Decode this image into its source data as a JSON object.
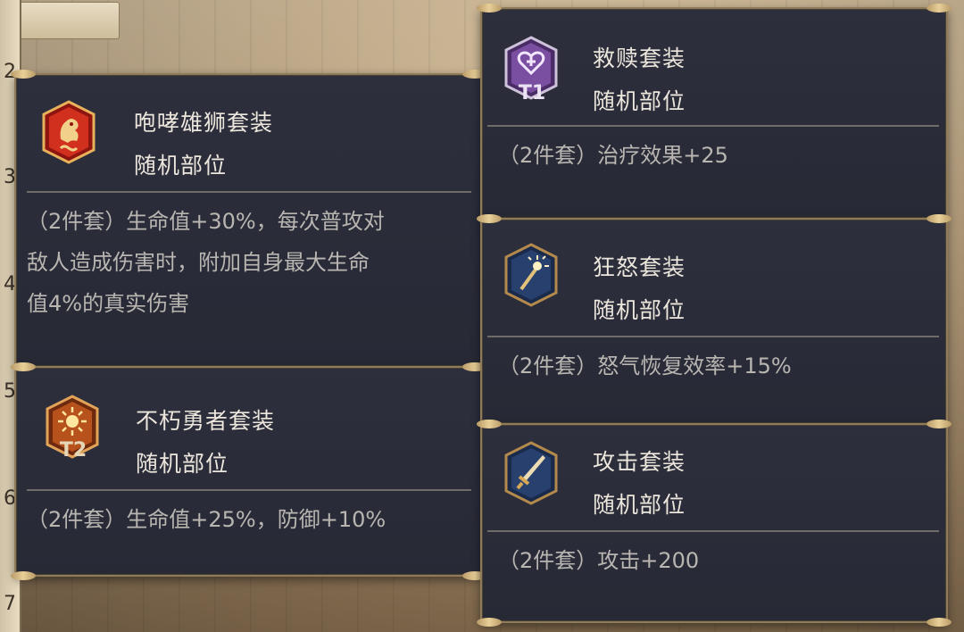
{
  "background": {
    "row_numbers": [
      "2",
      "3",
      "4",
      "5",
      "6",
      "7"
    ]
  },
  "sets": [
    {
      "name": "咆哮雄狮套装",
      "slot": "随机部位",
      "effect_lines": [
        "（2件套）生命值+30%，每次普攻对",
        "敌人造成伤害时，附加自身最大生命",
        "值4%的真实伤害"
      ],
      "icon": "lion-icon",
      "icon_color": "#c8261e",
      "tier": ""
    },
    {
      "name": "不朽勇者套装",
      "slot": "随机部位",
      "effect_lines": [
        "（2件套）生命值+25%，防御+10%"
      ],
      "icon": "sun-icon",
      "icon_color": "#b8521c",
      "tier": "T2"
    },
    {
      "name": "救赎套装",
      "slot": "随机部位",
      "effect_lines": [
        "（2件套）治疗效果+25"
      ],
      "icon": "heart-plus-icon",
      "icon_color": "#7a4ea0",
      "tier": "T1"
    },
    {
      "name": "狂怒套装",
      "slot": "随机部位",
      "effect_lines": [
        "（2件套）怒气恢复效率+15%"
      ],
      "icon": "staff-icon",
      "icon_color": "#27406e",
      "tier": ""
    },
    {
      "name": "攻击套装",
      "slot": "随机部位",
      "effect_lines": [
        "（2件套）攻击+200"
      ],
      "icon": "sword-icon",
      "icon_color": "#27406e",
      "tier": ""
    }
  ]
}
